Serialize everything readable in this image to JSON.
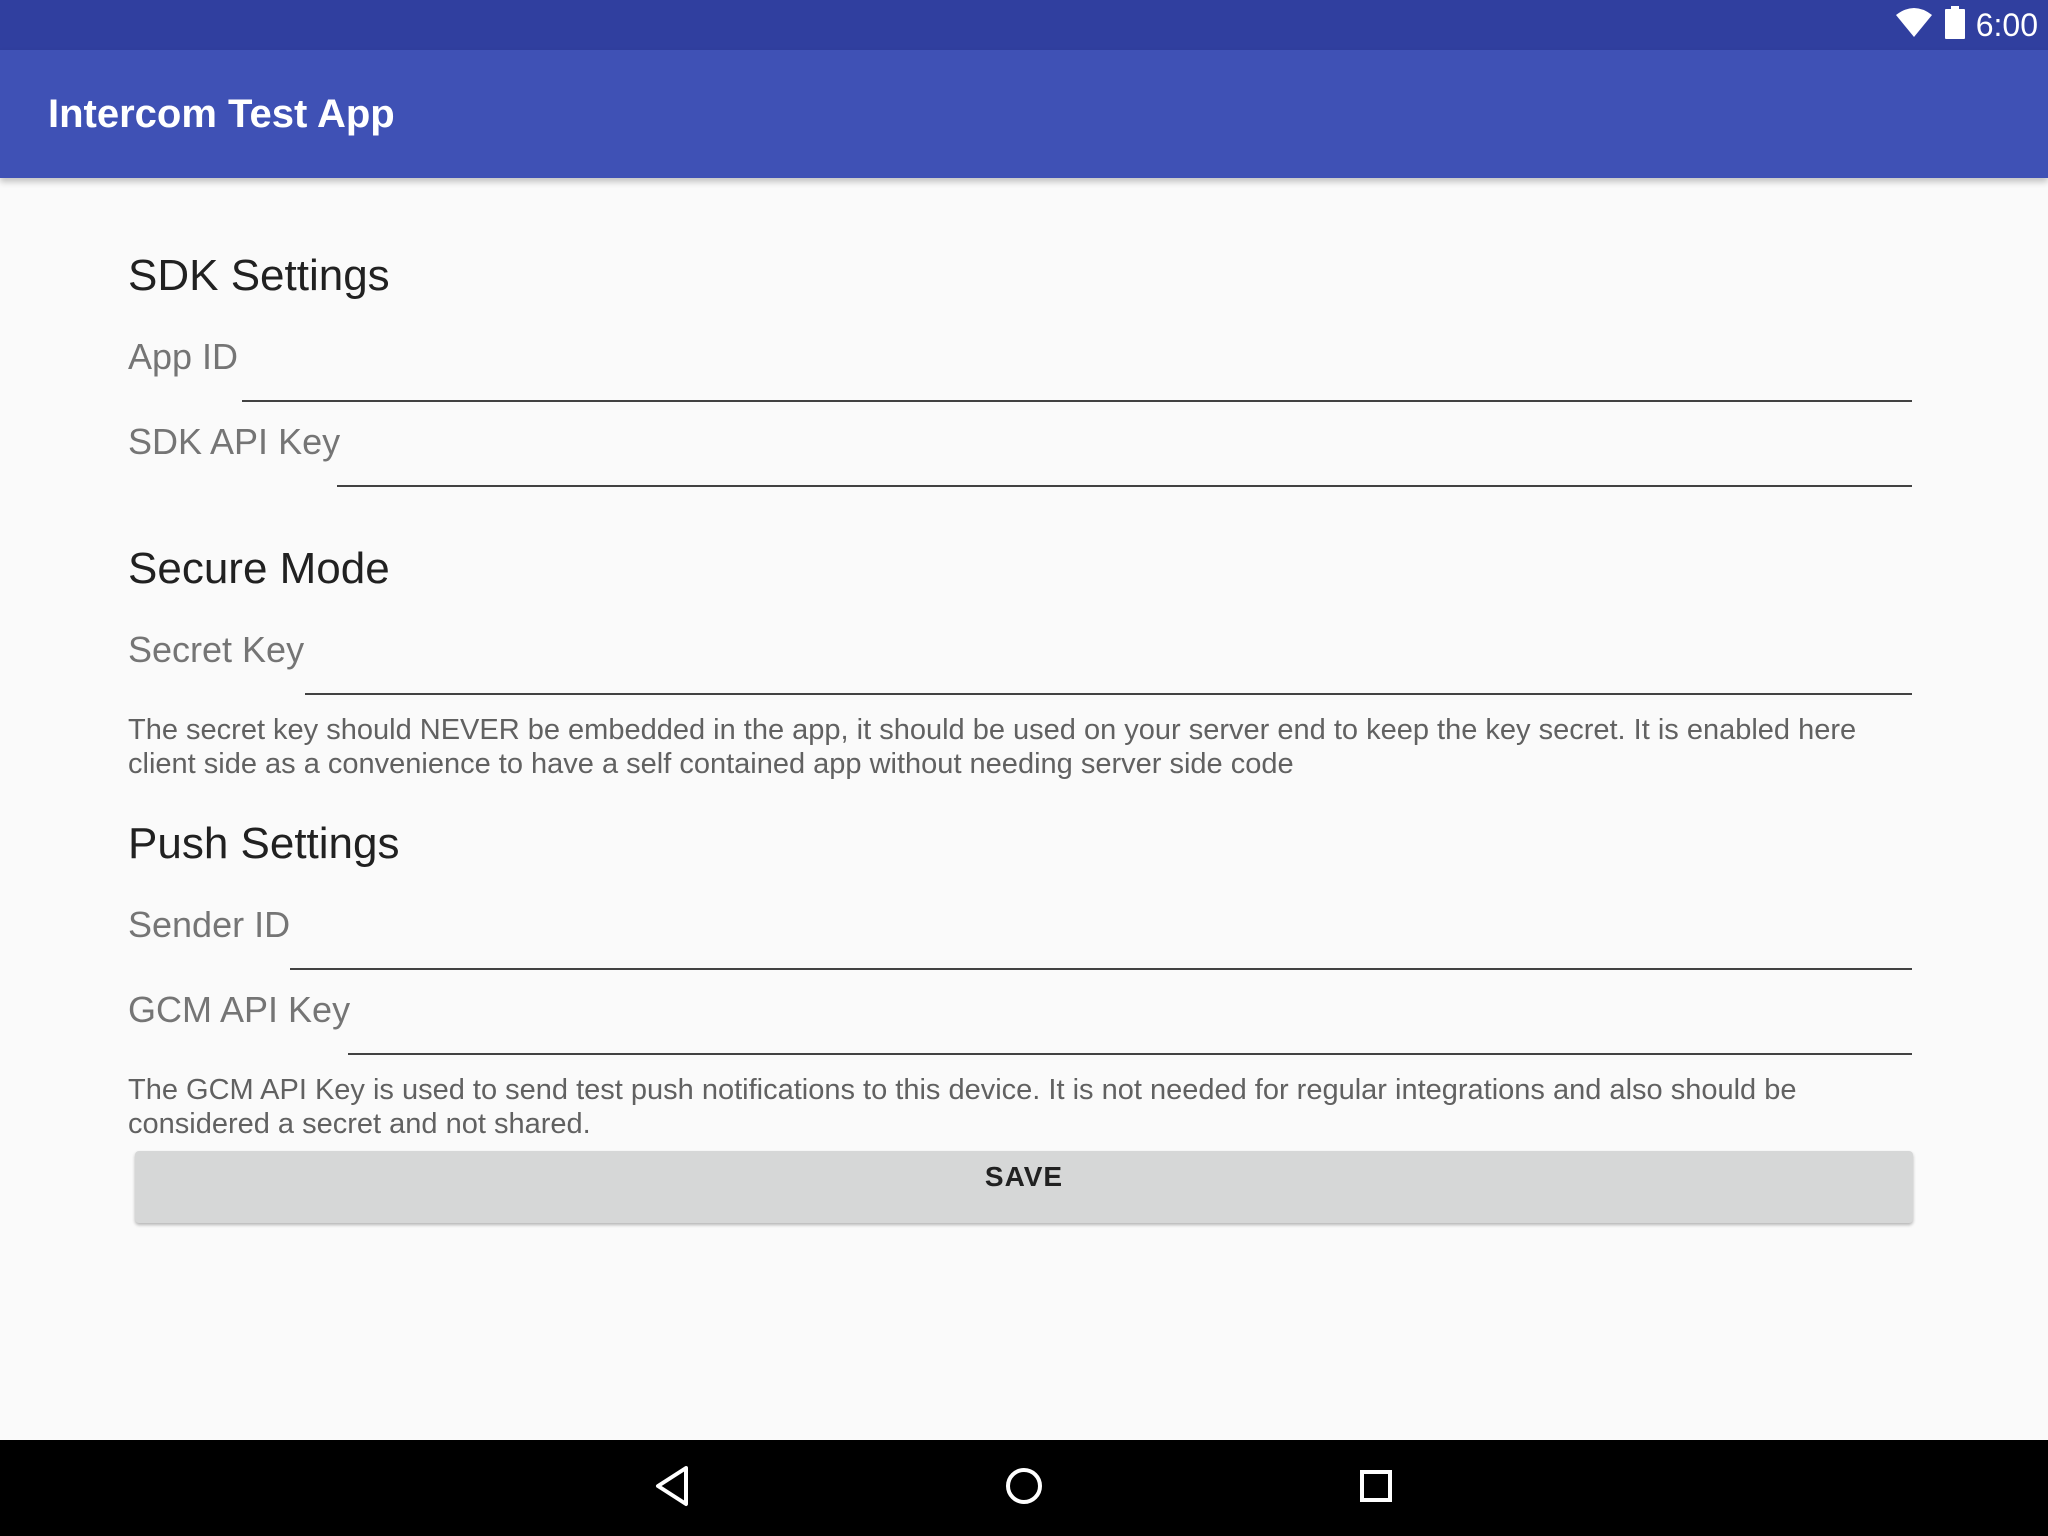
{
  "status_bar": {
    "time": "6:00",
    "icons": [
      "wifi-icon",
      "battery-icon"
    ]
  },
  "app_bar": {
    "title": "Intercom Test App"
  },
  "sdk_settings": {
    "heading": "SDK Settings",
    "app_id": {
      "label": "App ID",
      "value": ""
    },
    "sdk_api_key": {
      "label": "SDK API Key",
      "value": ""
    }
  },
  "secure_mode": {
    "heading": "Secure Mode",
    "secret_key": {
      "label": "Secret Key",
      "value": ""
    },
    "help": "The secret key should NEVER be embedded in the app, it should be used on your server end to keep the key secret. It is enabled here client side as a convenience to have a self contained app without needing server side code"
  },
  "push_settings": {
    "heading": "Push Settings",
    "sender_id": {
      "label": "Sender ID",
      "value": ""
    },
    "gcm_api_key": {
      "label": "GCM API Key",
      "value": ""
    },
    "help": "The GCM API Key is used to send test push notifications to this device. It is not needed for regular integrations and also should be considered a secret and not shared."
  },
  "actions": {
    "save_label": "SAVE"
  },
  "nav_bar": {
    "icons": [
      "back-icon",
      "home-icon",
      "recents-icon"
    ]
  },
  "colors": {
    "status_bar": "#303f9f",
    "app_bar": "#3f51b5",
    "background": "#fafafa",
    "button": "#d6d7d7"
  }
}
